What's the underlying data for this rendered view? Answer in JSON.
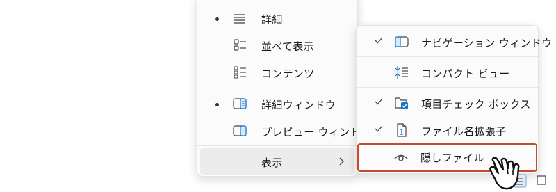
{
  "main_menu": {
    "items": [
      {
        "label": "詳細",
        "icon": "details-lines-icon",
        "bullet": true
      },
      {
        "label": "並べて表示",
        "icon": "tiles-icon",
        "bullet": false
      },
      {
        "label": "コンテンツ",
        "icon": "content-list-icon",
        "bullet": false
      },
      {
        "label": "詳細ウィンドウ",
        "icon": "details-pane-icon",
        "bullet": true
      },
      {
        "label": "プレビュー ウィンドウ",
        "icon": "preview-pane-icon",
        "bullet": false
      }
    ],
    "show": {
      "label": "表示",
      "icon": "chevron-right-icon"
    }
  },
  "sub_menu": {
    "items": [
      {
        "label": "ナビゲーション ウィンドウ",
        "icon": "navigation-pane-icon",
        "checked": true
      },
      {
        "label": "コンパクト ビュー",
        "icon": "compact-view-icon",
        "checked": false
      },
      {
        "label": "項目チェック ボックス",
        "icon": "item-checkbox-icon",
        "checked": true
      },
      {
        "label": "ファイル名拡張子",
        "icon": "file-extension-icon",
        "checked": true
      },
      {
        "label": "隠しファイル",
        "icon": "eye-icon",
        "checked": false,
        "highlighted": true
      }
    ]
  },
  "colors": {
    "accent": "#1a73c8",
    "highlight_border": "#c44b32",
    "hover_bg": "#ececec"
  }
}
